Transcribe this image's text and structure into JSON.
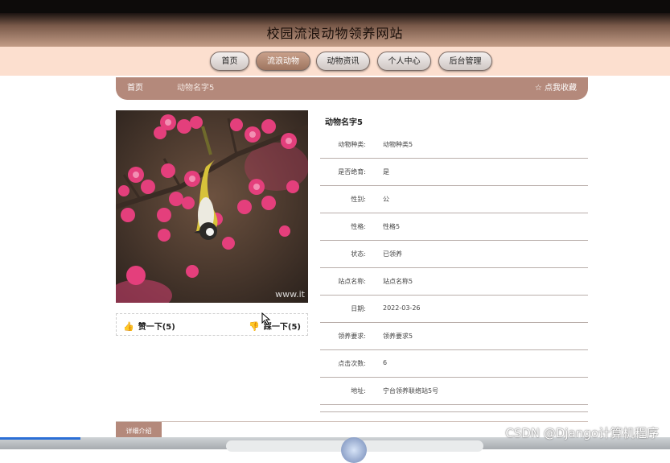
{
  "site": {
    "title": "校园流浪动物领养网站"
  },
  "nav": {
    "items": [
      {
        "label": "首页"
      },
      {
        "label": "流浪动物"
      },
      {
        "label": "动物资讯"
      },
      {
        "label": "个人中心"
      },
      {
        "label": "后台管理"
      }
    ],
    "active_index": 1
  },
  "breadcrumb": {
    "home": "首页",
    "current": "动物名字5",
    "collect": "☆ 点我收藏"
  },
  "photo": {
    "watermark": "www.it"
  },
  "votes": {
    "like": "赞一下(5)",
    "dislike": "踩一下(5)"
  },
  "detail": {
    "name": "动物名字5",
    "rows": [
      {
        "label": "动物种类:",
        "value": "动物种类5"
      },
      {
        "label": "是否绝育:",
        "value": "是"
      },
      {
        "label": "性别:",
        "value": "公"
      },
      {
        "label": "性格:",
        "value": "性格5"
      },
      {
        "label": "状态:",
        "value": "已领养"
      },
      {
        "label": "站点名称:",
        "value": "站点名称5"
      },
      {
        "label": "日期:",
        "value": "2022-03-26"
      },
      {
        "label": "领养要求:",
        "value": "领养要求5"
      },
      {
        "label": "点击次数:",
        "value": "6"
      },
      {
        "label": "地址:",
        "value": "宁台领养联络站5号"
      }
    ]
  },
  "tabs": {
    "detail": "详细介绍"
  },
  "watermark": "CSDN @Django计算机程序",
  "colors": {
    "accent": "#b4897b",
    "nav_bg": "#fcdfcf",
    "heart": "#d33a2c"
  }
}
